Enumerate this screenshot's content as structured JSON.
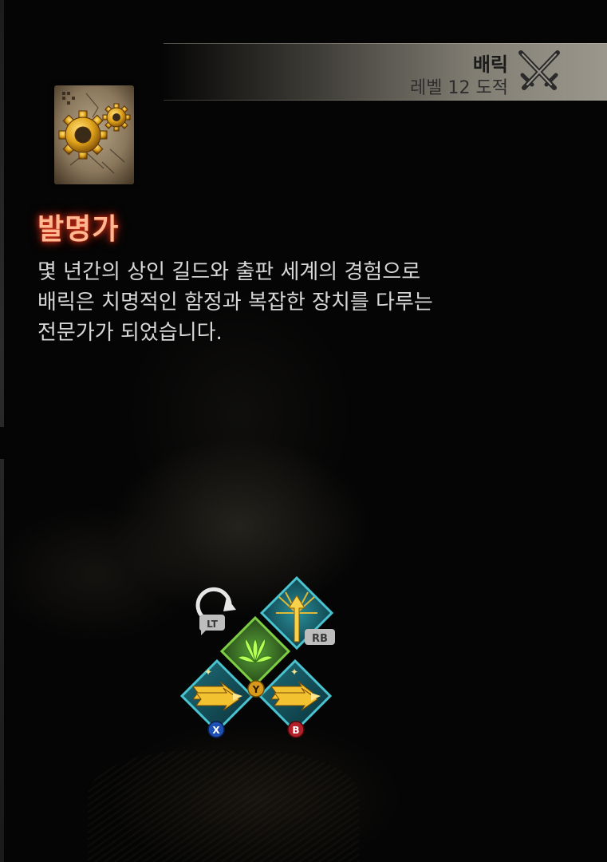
{
  "character": {
    "name": "배릭",
    "level_class": "레벨 12 도적",
    "class_icon": "crossed-daggers-icon"
  },
  "talent": {
    "icon": "gears-scroll-icon",
    "title": "발명가",
    "description_lines": [
      "몇 년간의 상인 길드와 출판 세계의 경험으로",
      "배릭은 치명적인 함정과 복잡한 장치를 다루는",
      "전문가가 되었습니다."
    ]
  },
  "controls": {
    "lt": "LT",
    "rb": "RB",
    "x": "X",
    "y": "Y",
    "b": "B"
  },
  "colors": {
    "title_glow": "#e0341a",
    "skill_border": "#3fb7c7",
    "skill_gold": "#f2c230",
    "button_x": "#1e4fb5",
    "button_y": "#d99a1c",
    "button_b": "#b3202a"
  }
}
